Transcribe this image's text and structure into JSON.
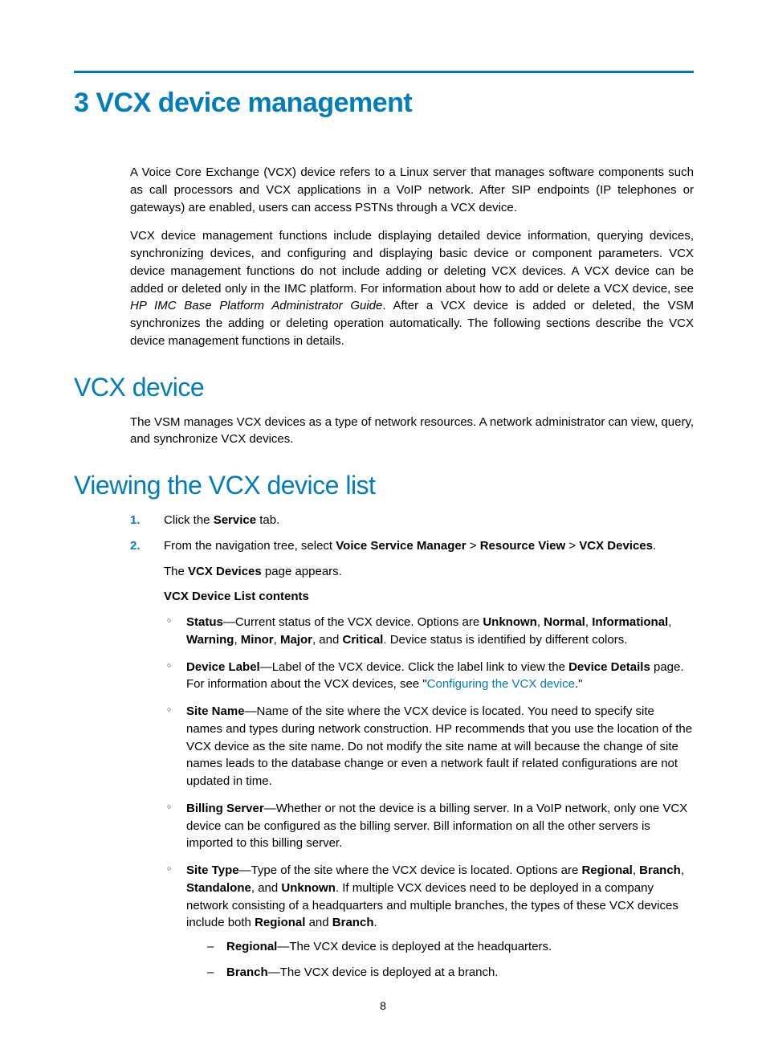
{
  "chapter_title": "3 VCX device management",
  "intro_p1": "A Voice Core Exchange (VCX) device refers to a Linux server that manages software components such as call processors and VCX applications in a VoIP network. After SIP endpoints (IP telephones or gateways) are enabled, users can access PSTNs through a VCX device.",
  "intro_p2_a": "VCX device management functions include displaying detailed device information, querying devices, synchronizing devices, and configuring and displaying basic device or component parameters. VCX device management functions do not include adding or deleting VCX devices. A VCX device can be added or deleted only in the IMC platform. For information about how to add or delete a VCX device, see ",
  "intro_p2_ref": "HP IMC Base Platform Administrator Guide",
  "intro_p2_b": ". After a VCX device is added or deleted, the VSM synchronizes the adding or deleting operation automatically. The following sections describe the VCX device management functions in details.",
  "h2_a": "VCX device",
  "h2_a_body": "The VSM manages VCX devices as a type of network resources. A network administrator can view, query, and synchronize VCX devices.",
  "h2_b": "Viewing the VCX device list",
  "steps": {
    "s1_a": "Click the ",
    "s1_b": "Service",
    "s1_c": " tab.",
    "s2_a": "From the navigation tree, select ",
    "s2_b": "Voice Service Manager",
    "s2_c": " > ",
    "s2_d": "Resource View",
    "s2_e": " > ",
    "s2_f": "VCX Devices",
    "s2_g": ".",
    "s2_sub_a": "The ",
    "s2_sub_b": "VCX Devices",
    "s2_sub_c": " page appears.",
    "s2_sub2": "VCX Device List contents"
  },
  "bullets": {
    "status_label": "Status",
    "status_a": "—Current status of the VCX device. Options are ",
    "status_o1": "Unknown",
    "status_s": ", ",
    "status_o2": "Normal",
    "status_o3": "Informational",
    "status_o4": "Warning",
    "status_o5": "Minor",
    "status_o6": "Major",
    "status_and": ", and ",
    "status_o7": "Critical",
    "status_b": ". Device status is identified by different colors.",
    "label_label": "Device Label",
    "label_a": "—Label of the VCX device. Click the label link to view the ",
    "label_bold": "Device Details",
    "label_b": " page. For information about the VCX devices, see \"",
    "label_link": "Configuring the VCX device",
    "label_c": ".\"",
    "site_label": "Site Name",
    "site_text": "—Name of the site where the VCX device is located. You need to specify site names and types during network construction. HP recommends that you use the location of the VCX device as the site name. Do not modify the site name at will because the change of site names leads to the database change or even a network fault if related configurations are not updated in time.",
    "bill_label": "Billing Server",
    "bill_text": "—Whether or not the device is a billing server. In a VoIP network, only one VCX device can be configured as the billing server. Bill information on all the other servers is imported to this billing server.",
    "type_label": "Site Type",
    "type_a": "—Type of the site where the VCX device is located. Options are ",
    "type_o1": "Regional",
    "type_o2": "Branch",
    "type_o3": "Standalone",
    "type_o4": "Unknown",
    "type_b": ". If multiple VCX devices need to be deployed in a company network consisting of a headquarters and multiple branches, the types of these VCX devices include both ",
    "type_c": " and ",
    "type_d": ".",
    "dash1_label": "Regional",
    "dash1_text": "—The VCX device is deployed at the headquarters.",
    "dash2_label": "Branch",
    "dash2_text": "—The VCX device is deployed at a branch."
  },
  "page_number": "8"
}
